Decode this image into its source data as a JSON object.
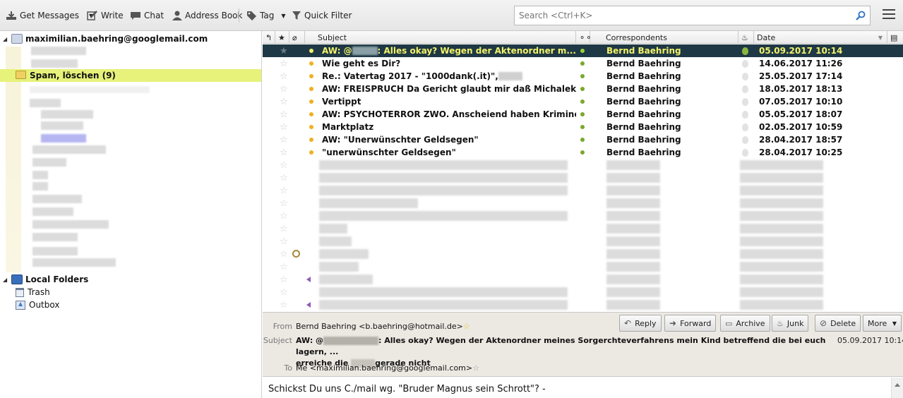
{
  "toolbar": {
    "get_messages": "Get Messages",
    "write": "Write",
    "chat": "Chat",
    "address_book": "Address Book",
    "tag": "Tag",
    "quick_filter": "Quick Filter",
    "search_placeholder": "Search <Ctrl+K>"
  },
  "folders": {
    "account": "maximilian.baehring@googlemail.com",
    "spam": "Spam, löschen (9)",
    "local_folders": "Local Folders",
    "trash": "Trash",
    "outbox": "Outbox"
  },
  "columns": {
    "subject": "Subject",
    "correspondents": "Correspondents",
    "date": "Date"
  },
  "messages": [
    {
      "subject_prefix": "AW: @",
      "subject_suffix": ": Alles okay? Wegen der Aktenordner m...",
      "from": "Bernd Baehring",
      "date": "05.09.2017 10:14"
    },
    {
      "subject": "Wie geht es Dir?",
      "from": "Bernd Baehring",
      "date": "14.06.2017 11:26"
    },
    {
      "subject": "Re.: Vatertag 2017 - \"1000dank(.it)\",",
      "from": "Bernd Baehring",
      "date": "25.05.2017 17:14"
    },
    {
      "subject": "AW: FREISPRUCH Da Gericht glaubt mir daß Michalek mich ge...",
      "from": "Bernd Baehring",
      "date": "18.05.2017 18:13"
    },
    {
      "subject": "Vertippt",
      "from": "Bernd Baehring",
      "date": "07.05.2017 10:10"
    },
    {
      "subject": "AW: PSYCHOTERROR ZWO. Anscheiend haben Kriminelle sich a...",
      "from": "Bernd Baehring",
      "date": "05.05.2017 18:07"
    },
    {
      "subject": "Marktplatz",
      "from": "Bernd Baehring",
      "date": "02.05.2017 10:59"
    },
    {
      "subject": "AW: \"Unerwünschter Geldsegen\"",
      "from": "Bernd Baehring",
      "date": "28.04.2017 18:57"
    },
    {
      "subject": "\"unerwünschter Geldsegen\"",
      "from": "Bernd Baehring",
      "date": "28.04.2017 10:25"
    }
  ],
  "header": {
    "from_label": "From",
    "from_value": "Bernd Baehring <b.baehring@hotmail.de>",
    "subject_label": "Subject",
    "subject_line1_prefix": "AW: @",
    "subject_line1_suffix": ": Alles okay? Wegen der Aktenordner meines Sorgerchteverfahrens mein Kind betreffend die bei euch lagern, ...",
    "subject_line2_prefix": "erreiche die",
    "subject_line2_suffix": "gerade nicht",
    "date": "05.09.2017 10:14",
    "to_label": "To",
    "to_value": "Me <maximilian.baehring@googlemail.com>",
    "buttons": {
      "reply": "Reply",
      "forward": "Forward",
      "archive": "Archive",
      "junk": "Junk",
      "delete": "Delete",
      "more": "More"
    }
  },
  "body": {
    "text": "Schickst Du uns C./mail wg. \"Bruder Magnus sein Schrott\"? -"
  }
}
